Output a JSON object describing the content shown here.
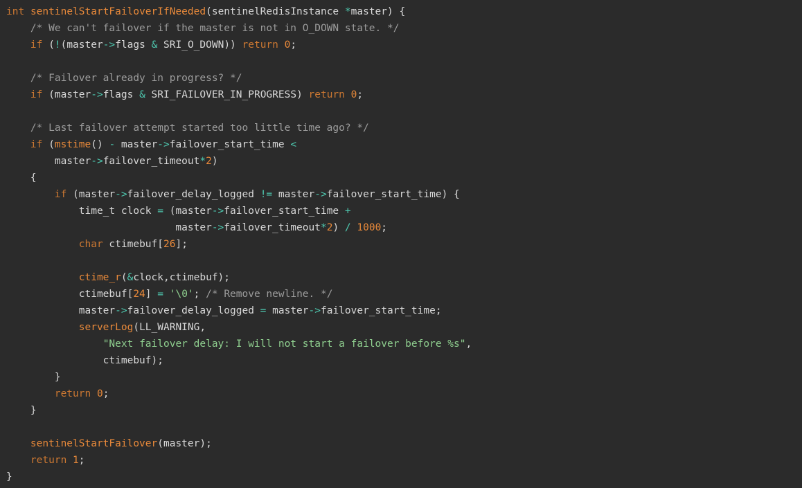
{
  "colors": {
    "background": "#2b2b2b",
    "text": "#d8d8d8",
    "keyword": "#cc7832",
    "function": "#e8893a",
    "operator": "#4ec9b0",
    "number": "#e8893a",
    "string": "#8fcf8f",
    "comment": "#9c9c9c"
  },
  "code": {
    "lines": [
      [
        [
          "kw",
          "int"
        ],
        [
          "tx",
          " "
        ],
        [
          "fn",
          "sentinelStartFailoverIfNeeded"
        ],
        [
          "tx",
          "(sentinelRedisInstance "
        ],
        [
          "op",
          "*"
        ],
        [
          "tx",
          "master) {"
        ]
      ],
      [
        [
          "tx",
          "    "
        ],
        [
          "cm",
          "/* We can't failover if the master is not in O_DOWN state. */"
        ]
      ],
      [
        [
          "tx",
          "    "
        ],
        [
          "kw",
          "if"
        ],
        [
          "tx",
          " ("
        ],
        [
          "op",
          "!"
        ],
        [
          "tx",
          "(master"
        ],
        [
          "op",
          "->"
        ],
        [
          "tx",
          "flags "
        ],
        [
          "op",
          "&"
        ],
        [
          "tx",
          " SRI_O_DOWN)) "
        ],
        [
          "kw",
          "return"
        ],
        [
          "tx",
          " "
        ],
        [
          "num",
          "0"
        ],
        [
          "tx",
          ";"
        ]
      ],
      [],
      [
        [
          "tx",
          "    "
        ],
        [
          "cm",
          "/* Failover already in progress? */"
        ]
      ],
      [
        [
          "tx",
          "    "
        ],
        [
          "kw",
          "if"
        ],
        [
          "tx",
          " (master"
        ],
        [
          "op",
          "->"
        ],
        [
          "tx",
          "flags "
        ],
        [
          "op",
          "&"
        ],
        [
          "tx",
          " SRI_FAILOVER_IN_PROGRESS) "
        ],
        [
          "kw",
          "return"
        ],
        [
          "tx",
          " "
        ],
        [
          "num",
          "0"
        ],
        [
          "tx",
          ";"
        ]
      ],
      [],
      [
        [
          "tx",
          "    "
        ],
        [
          "cm",
          "/* Last failover attempt started too little time ago? */"
        ]
      ],
      [
        [
          "tx",
          "    "
        ],
        [
          "kw",
          "if"
        ],
        [
          "tx",
          " ("
        ],
        [
          "fn",
          "mstime"
        ],
        [
          "tx",
          "() "
        ],
        [
          "op",
          "-"
        ],
        [
          "tx",
          " master"
        ],
        [
          "op",
          "->"
        ],
        [
          "tx",
          "failover_start_time "
        ],
        [
          "op",
          "<"
        ]
      ],
      [
        [
          "tx",
          "        master"
        ],
        [
          "op",
          "->"
        ],
        [
          "tx",
          "failover_timeout"
        ],
        [
          "op",
          "*"
        ],
        [
          "num",
          "2"
        ],
        [
          "tx",
          ")"
        ]
      ],
      [
        [
          "tx",
          "    {"
        ]
      ],
      [
        [
          "tx",
          "        "
        ],
        [
          "kw",
          "if"
        ],
        [
          "tx",
          " (master"
        ],
        [
          "op",
          "->"
        ],
        [
          "tx",
          "failover_delay_logged "
        ],
        [
          "op",
          "!="
        ],
        [
          "tx",
          " master"
        ],
        [
          "op",
          "->"
        ],
        [
          "tx",
          "failover_start_time) {"
        ]
      ],
      [
        [
          "tx",
          "            time_t clock "
        ],
        [
          "op",
          "="
        ],
        [
          "tx",
          " (master"
        ],
        [
          "op",
          "->"
        ],
        [
          "tx",
          "failover_start_time "
        ],
        [
          "op",
          "+"
        ]
      ],
      [
        [
          "tx",
          "                            master"
        ],
        [
          "op",
          "->"
        ],
        [
          "tx",
          "failover_timeout"
        ],
        [
          "op",
          "*"
        ],
        [
          "num",
          "2"
        ],
        [
          "tx",
          ") "
        ],
        [
          "op",
          "/"
        ],
        [
          "tx",
          " "
        ],
        [
          "num",
          "1000"
        ],
        [
          "tx",
          ";"
        ]
      ],
      [
        [
          "tx",
          "            "
        ],
        [
          "kw",
          "char"
        ],
        [
          "tx",
          " ctimebuf["
        ],
        [
          "num",
          "26"
        ],
        [
          "tx",
          "];"
        ]
      ],
      [],
      [
        [
          "tx",
          "            "
        ],
        [
          "fn",
          "ctime_r"
        ],
        [
          "tx",
          "("
        ],
        [
          "op",
          "&"
        ],
        [
          "tx",
          "clock,ctimebuf);"
        ]
      ],
      [
        [
          "tx",
          "            ctimebuf["
        ],
        [
          "num",
          "24"
        ],
        [
          "tx",
          "] "
        ],
        [
          "op",
          "="
        ],
        [
          "tx",
          " "
        ],
        [
          "str",
          "'\\0'"
        ],
        [
          "tx",
          "; "
        ],
        [
          "cm",
          "/* Remove newline. */"
        ]
      ],
      [
        [
          "tx",
          "            master"
        ],
        [
          "op",
          "->"
        ],
        [
          "tx",
          "failover_delay_logged "
        ],
        [
          "op",
          "="
        ],
        [
          "tx",
          " master"
        ],
        [
          "op",
          "->"
        ],
        [
          "tx",
          "failover_start_time;"
        ]
      ],
      [
        [
          "tx",
          "            "
        ],
        [
          "fn",
          "serverLog"
        ],
        [
          "tx",
          "(LL_WARNING,"
        ]
      ],
      [
        [
          "tx",
          "                "
        ],
        [
          "str",
          "\"Next failover delay: I will not start a failover before %s\""
        ],
        [
          "tx",
          ","
        ]
      ],
      [
        [
          "tx",
          "                ctimebuf);"
        ]
      ],
      [
        [
          "tx",
          "        }"
        ]
      ],
      [
        [
          "tx",
          "        "
        ],
        [
          "kw",
          "return"
        ],
        [
          "tx",
          " "
        ],
        [
          "num",
          "0"
        ],
        [
          "tx",
          ";"
        ]
      ],
      [
        [
          "tx",
          "    }"
        ]
      ],
      [],
      [
        [
          "tx",
          "    "
        ],
        [
          "fn",
          "sentinelStartFailover"
        ],
        [
          "tx",
          "(master);"
        ]
      ],
      [
        [
          "tx",
          "    "
        ],
        [
          "kw",
          "return"
        ],
        [
          "tx",
          " "
        ],
        [
          "num",
          "1"
        ],
        [
          "tx",
          ";"
        ]
      ],
      [
        [
          "tx",
          "}"
        ]
      ]
    ]
  }
}
